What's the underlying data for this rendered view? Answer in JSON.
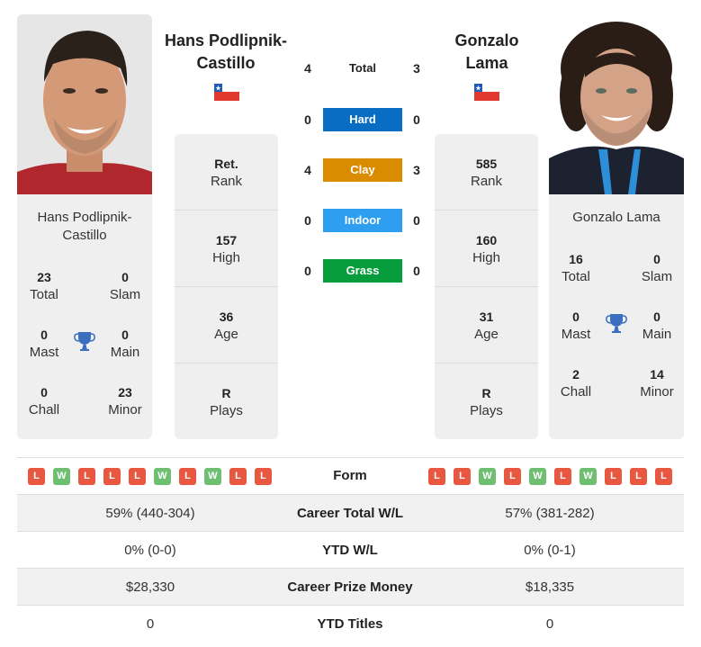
{
  "colors": {
    "hard": "#0a6dc4",
    "clay": "#db8b00",
    "indoor": "#2e9ef0",
    "grass": "#079c3c",
    "loss": "#e8573f",
    "win": "#6fbf73",
    "trophy": "#3a6fbf"
  },
  "player1": {
    "name": "Hans Podlipnik-Castillo",
    "header_line1": "Hans Podlipnik-",
    "header_line2": "Castillo",
    "card_line1": "Hans Podlipnik-",
    "card_line2": "Castillo",
    "country_flag": "chile-flag",
    "rank": {
      "value": "Ret.",
      "label": "Rank"
    },
    "high": {
      "value": "157",
      "label": "High"
    },
    "age": {
      "value": "36",
      "label": "Age"
    },
    "plays": {
      "value": "R",
      "label": "Plays"
    },
    "titles": {
      "total": {
        "value": "23",
        "label": "Total"
      },
      "slam": {
        "value": "0",
        "label": "Slam"
      },
      "mast": {
        "value": "0",
        "label": "Mast"
      },
      "main": {
        "value": "0",
        "label": "Main"
      },
      "chall": {
        "value": "0",
        "label": "Chall"
      },
      "minor": {
        "value": "23",
        "label": "Minor"
      }
    },
    "form": [
      "L",
      "W",
      "L",
      "L",
      "L",
      "W",
      "L",
      "W",
      "L",
      "L"
    ]
  },
  "player2": {
    "name": "Gonzalo Lama",
    "header_line1": "Gonzalo",
    "header_line2": "Lama",
    "card_line1": "Gonzalo Lama",
    "country_flag": "chile-flag",
    "rank": {
      "value": "585",
      "label": "Rank"
    },
    "high": {
      "value": "160",
      "label": "High"
    },
    "age": {
      "value": "31",
      "label": "Age"
    },
    "plays": {
      "value": "R",
      "label": "Plays"
    },
    "titles": {
      "total": {
        "value": "16",
        "label": "Total"
      },
      "slam": {
        "value": "0",
        "label": "Slam"
      },
      "mast": {
        "value": "0",
        "label": "Mast"
      },
      "main": {
        "value": "0",
        "label": "Main"
      },
      "chall": {
        "value": "2",
        "label": "Chall"
      },
      "minor": {
        "value": "14",
        "label": "Minor"
      }
    },
    "form": [
      "L",
      "L",
      "W",
      "L",
      "W",
      "L",
      "W",
      "L",
      "L",
      "L"
    ]
  },
  "h2h": {
    "total": {
      "label": "Total",
      "p1": "4",
      "p2": "3"
    },
    "hard": {
      "label": "Hard",
      "p1": "0",
      "p2": "0"
    },
    "clay": {
      "label": "Clay",
      "p1": "4",
      "p2": "3"
    },
    "indoor": {
      "label": "Indoor",
      "p1": "0",
      "p2": "0"
    },
    "grass": {
      "label": "Grass",
      "p1": "0",
      "p2": "0"
    }
  },
  "table": {
    "form_label": "Form",
    "rows": [
      {
        "label": "Career Total W/L",
        "p1": "59% (440-304)",
        "p2": "57% (381-282)"
      },
      {
        "label": "YTD W/L",
        "p1": "0% (0-0)",
        "p2": "0% (0-1)"
      },
      {
        "label": "Career Prize Money",
        "p1": "$28,330",
        "p2": "$18,335"
      },
      {
        "label": "YTD Titles",
        "p1": "0",
        "p2": "0"
      }
    ]
  }
}
